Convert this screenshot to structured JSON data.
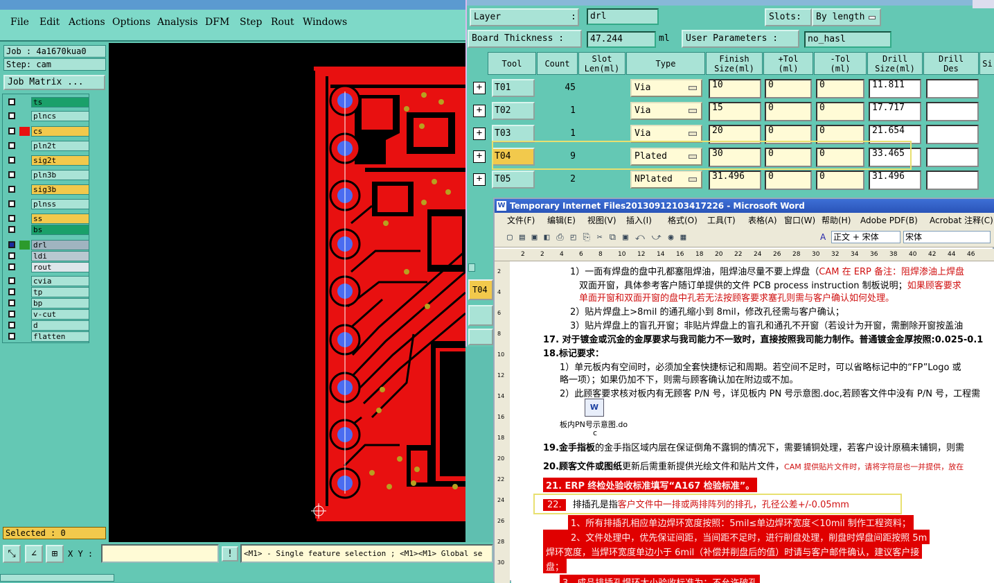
{
  "genesis": {
    "menu": [
      {
        "label": "File",
        "ul": ""
      },
      {
        "label": "Edit",
        "ul": ""
      },
      {
        "label": "Actions",
        "ul": ""
      },
      {
        "label": "Options",
        "ul": ""
      },
      {
        "label": "Analysis",
        "ul": ""
      },
      {
        "label": "DFM",
        "ul": ""
      },
      {
        "label": "Step",
        "ul": ""
      },
      {
        "label": "Rout",
        "ul": ""
      },
      {
        "label": "Windows",
        "ul": ""
      }
    ],
    "job": "Job : 4a1670kua0",
    "step": "Step: cam",
    "job_matrix": "Job Matrix ...",
    "layers": [
      {
        "name": "ts",
        "color": "#1aa06a",
        "swatch": ""
      },
      {
        "name": "plncs",
        "color": "#a9e3d6",
        "swatch": ""
      },
      {
        "name": "cs",
        "color": "#f2c94c",
        "swatch": "#e81010"
      },
      {
        "name": "pln2t",
        "color": "#a9e3d6",
        "swatch": ""
      },
      {
        "name": "sig2t",
        "color": "#f2c94c",
        "swatch": ""
      },
      {
        "name": "pln3b",
        "color": "#a9e3d6",
        "swatch": ""
      },
      {
        "name": "sig3b",
        "color": "#f2c94c",
        "swatch": ""
      },
      {
        "name": "plnss",
        "color": "#a9e3d6",
        "swatch": ""
      },
      {
        "name": "ss",
        "color": "#f2c94c",
        "swatch": ""
      },
      {
        "name": "bs",
        "color": "#1aa06a",
        "swatch": ""
      },
      {
        "name": "drl",
        "color": "#a0b4c0",
        "swatch": "#2c9a2c"
      },
      {
        "name": "ldi",
        "color": "#b8c8d0",
        "swatch": ""
      },
      {
        "name": "rout",
        "color": "#dde6ea",
        "swatch": ""
      },
      {
        "name": "cvia",
        "color": "#a9e3d6",
        "swatch": ""
      },
      {
        "name": "tp",
        "color": "#a9e3d6",
        "swatch": ""
      },
      {
        "name": "bp",
        "color": "#a9e3d6",
        "swatch": ""
      },
      {
        "name": "v-cut",
        "color": "#a9e3d6",
        "swatch": ""
      },
      {
        "name": "d",
        "color": "#a9e3d6",
        "swatch": ""
      },
      {
        "name": "flatten",
        "color": "#a9e3d6",
        "swatch": ""
      }
    ],
    "selected": "Selected : 0",
    "xy_label": "X Y :",
    "status_msg": "<M1> - Single feature selection ; <M1><M1> Global se"
  },
  "drill_manager": {
    "layer_label": "Layer",
    "layer_value": "drl",
    "slots_label": "Slots:",
    "slots_value": "By length",
    "thickness_label": "Board Thickness :",
    "thickness_value": "47.244",
    "thickness_unit": "ml",
    "user_params_label": "User Parameters :",
    "user_params_value": "no_hasl",
    "headers": [
      [
        "Tool",
        ""
      ],
      [
        "Count",
        ""
      ],
      [
        "Slot",
        "Len(ml)"
      ],
      [
        "Type",
        ""
      ],
      [
        "Finish",
        "Size(ml)"
      ],
      [
        "+Tol",
        "(ml)"
      ],
      [
        "-Tol",
        "(ml)"
      ],
      [
        "Drill",
        "Size(ml)"
      ],
      [
        "Drill",
        "Des"
      ],
      [
        "Si",
        ""
      ]
    ],
    "rows": [
      {
        "tool": "T01",
        "count": "45",
        "type": "Via",
        "finish": "10",
        "ptol": "0",
        "ntol": "0",
        "drill": "11.811"
      },
      {
        "tool": "T02",
        "count": "1",
        "type": "Via",
        "finish": "15",
        "ptol": "0",
        "ntol": "0",
        "drill": "17.717"
      },
      {
        "tool": "T03",
        "count": "1",
        "type": "Via",
        "finish": "20",
        "ptol": "0",
        "ntol": "0",
        "drill": "21.654"
      },
      {
        "tool": "T04",
        "count": "9",
        "type": "Plated",
        "finish": "30",
        "ptol": "0",
        "ntol": "0",
        "drill": "33.465"
      },
      {
        "tool": "T05",
        "count": "2",
        "type": "NPlated",
        "finish": "31.496",
        "ptol": "0",
        "ntol": "0",
        "drill": "31.496"
      }
    ],
    "current_tool": "T04"
  },
  "word": {
    "title": "Temporary Internet Files20130912103417226 - Microsoft Word",
    "menu": [
      "文件(F)",
      "编辑(E)",
      "视图(V)",
      "插入(I)",
      "格式(O)",
      "工具(T)",
      "表格(A)",
      "窗口(W)",
      "帮助(H)",
      "Adobe PDF(B)",
      "Acrobat 注释(C)"
    ],
    "style": "正文 + 宋体",
    "font": "宋体",
    "ruler": [
      "2",
      "2",
      "4",
      "6",
      "8",
      "10",
      "12",
      "14",
      "16",
      "18",
      "20",
      "22",
      "24",
      "26",
      "28",
      "30",
      "32",
      "34",
      "36",
      "38",
      "40",
      "42",
      "44",
      "46"
    ],
    "vruler": [
      "2",
      "4",
      "6",
      "8",
      "10",
      "12",
      "14",
      "16",
      "18",
      "20",
      "22",
      "24",
      "26",
      "28",
      "30"
    ],
    "lines": {
      "l1a": "1）一面有焊盘的盘中孔都塞阻焊油，阻焊油尽量不要上焊盘（",
      "l1b": "CAM 在 ERP 备注",
      "l1c": "：阻焊渗油上焊盘",
      "l2a": "双面开窗，具体参考客户随订单提供的文件 PCB process instruction 制板说明；",
      "l2b": "如果顾客要求",
      "l3": "单面开窗和双面开窗的盘中孔若无法按顾客要求塞孔则需与客户确认如何处理。",
      "l4": "2）贴片焊盘上>8mil 的通孔缩小到 8mil，修改孔径需与客户确认；",
      "l5": "3）贴片焊盘上的盲孔开窗；非贴片焊盘上的盲孔和通孔不开窗（若设计为开窗，需删除开窗按盖油",
      "l6": "17. 对于镀金或沉金的金厚要求与我司能力不一致时，直接按照我司能力制作。普通镀金金厚按照:0.025-0.1",
      "l7": "18.标记要求：",
      "l8": "1）单元板内有空间时，必须加全套快捷标记和周期。若空间不足时，可以省略标记中的“FP”Logo 或",
      "l9": "略一项）；如果仍加不下，则需与顾客确认加在附边或不加。",
      "l10": "2）此顾客要求核对板内有无顾客 P/N 号，详见板内 PN 号示意图.doc,若顾客文件中没有 P/N 号，工程需",
      "attach": "板内PN号示意图.do",
      "attach2": "c",
      "l11a": "19.金手指板",
      "l11b": "的金手指区域内层在保证倒角不露铜的情况下，需要铺铜处理，若客户设计原稿未铺铜，则需",
      "l12a": "20.顾客文件或图纸",
      "l12b": "更新后需重新提供光绘文件和贴片文件，",
      "l12c": "CAM 提供贴片文件时，请将字符层也一并提供，放在",
      "l13": "21. ERP 终检处验收标准填写“A167 检验标准”。",
      "l14a": "22.",
      "l14b": "排插孔是指",
      "l14c": "客户文件中一排或两排阵列的排孔，孔径公差+/-0.05mm",
      "l15": "1、所有排插孔相应单边焊环宽度按照：5mil≤单边焊环宽度＜10mil 制作工程资料；",
      "l16": "2、文件处理中，优先保证间距，当间距不足时，进行削盘处理，削盘时焊盘间距按照 5m",
      "l17": "焊环宽度，当焊环宽度单边小于 6mil（补偿并削盘后的值）时请与客户邮件确认，建议客户接",
      "l18": "盘；",
      "l19": "3、成品排插孔焊环大小验收标准为：不允许破孔"
    }
  }
}
